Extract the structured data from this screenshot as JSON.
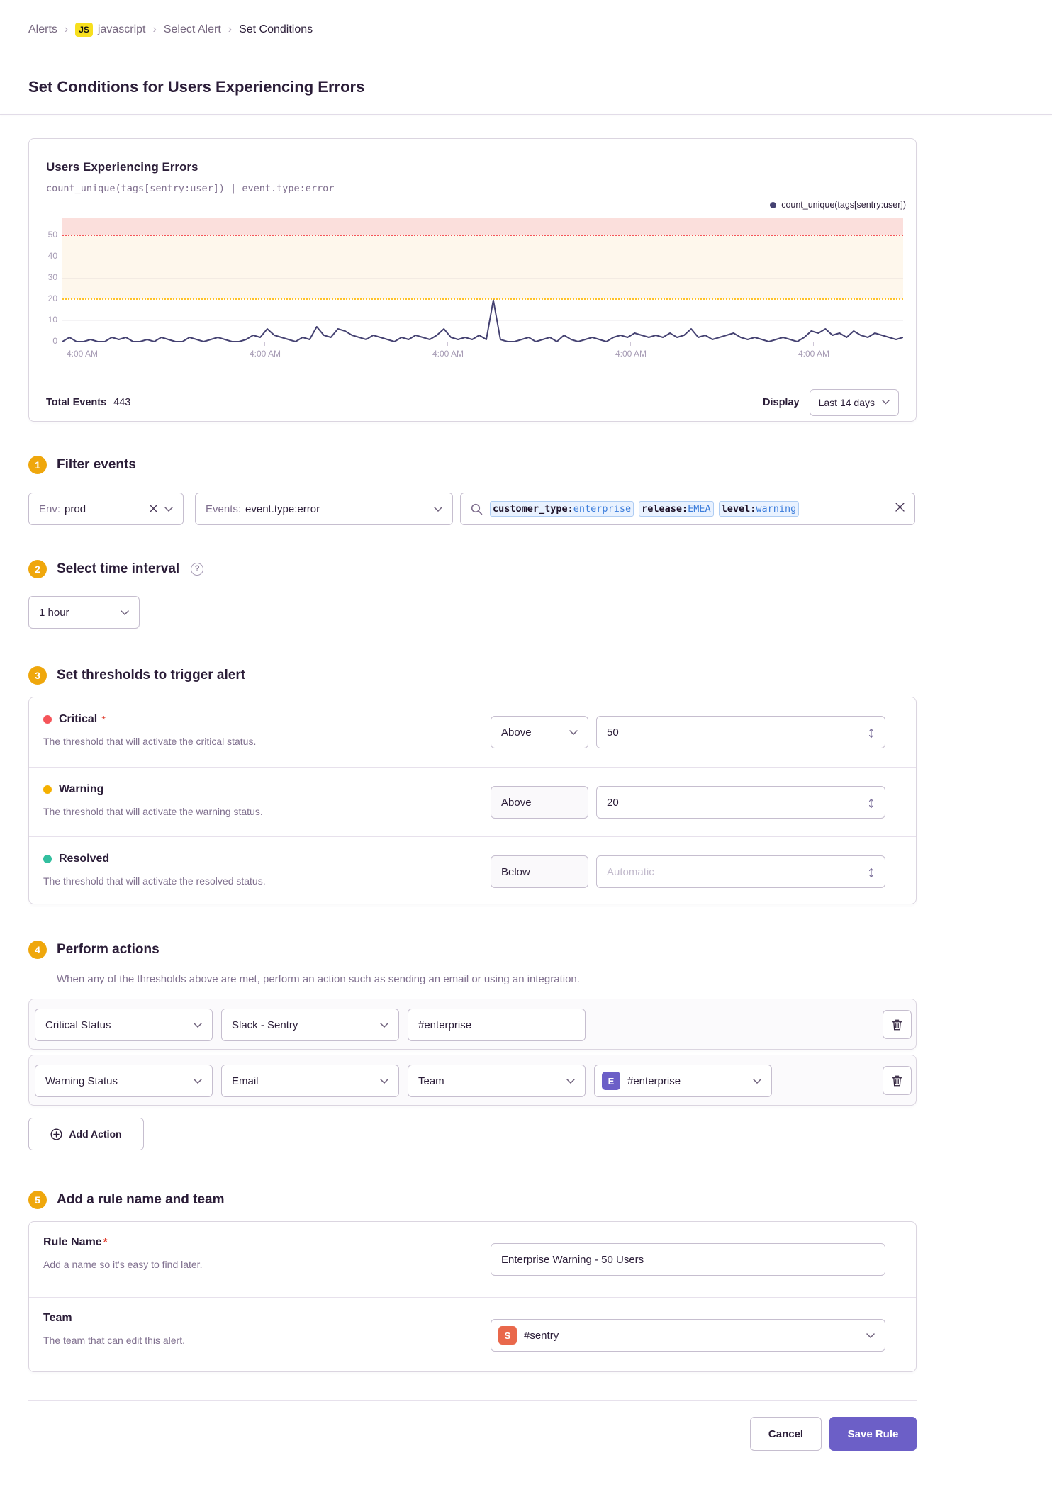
{
  "page": {
    "title": "Set Conditions for Users Experiencing Errors"
  },
  "breadcrumb": {
    "separator": "›",
    "project_badge": "JS",
    "items": [
      "Alerts",
      "javascript",
      "Select Alert",
      "Set Conditions"
    ]
  },
  "chart_panel": {
    "title": "Users Experiencing Errors",
    "query": "count_unique(tags[sentry:user]) | event.type:error",
    "legend": "count_unique(tags[sentry:user])",
    "total_events_label": "Total Events",
    "total_events_value": "443",
    "display_label": "Display",
    "range_value": "Last 14 days"
  },
  "chart_data": {
    "type": "line",
    "title": "Users Experiencing Errors",
    "series": [
      {
        "name": "count_unique(tags[sentry:user])",
        "values": [
          0,
          2,
          0,
          0,
          1,
          0,
          0,
          2,
          1,
          2,
          0,
          0,
          1,
          0,
          2,
          1,
          0,
          0,
          2,
          1,
          0,
          1,
          2,
          1,
          0,
          0,
          1,
          3,
          2,
          6,
          3,
          2,
          1,
          0,
          2,
          1,
          7,
          3,
          2,
          6,
          5,
          3,
          2,
          1,
          3,
          2,
          1,
          0,
          2,
          1,
          3,
          2,
          1,
          3,
          6,
          2,
          1,
          2,
          1,
          3,
          1,
          19.5,
          1,
          0,
          0,
          1,
          2,
          0,
          1,
          2,
          0,
          3,
          1,
          0,
          1,
          2,
          1,
          0,
          2,
          3,
          2,
          4,
          3,
          2,
          3,
          2,
          4,
          2,
          3,
          6,
          2,
          3,
          1,
          2,
          3,
          4,
          2,
          1,
          2,
          1,
          0,
          1,
          2,
          1,
          0,
          2,
          5,
          4,
          6,
          3,
          4,
          2,
          5,
          3,
          2,
          4,
          3,
          2,
          1,
          2
        ]
      }
    ],
    "ylim": [
      0,
      58.3
    ],
    "yticks": [
      0,
      10,
      20,
      30,
      40,
      50
    ],
    "xticks": [
      "4:00 AM",
      "4:00 AM",
      "4:00 AM",
      "4:00 AM",
      "4:00 AM"
    ],
    "thresholds": {
      "critical": 50,
      "warning": 20
    },
    "grid": true,
    "legend_position": "top-right",
    "colors": {
      "line": "#454272",
      "critical_line": "#F55459",
      "warning_line": "#FFC227",
      "critical_band": "#FBDFDC",
      "warning_band": "#FEF7EC"
    }
  },
  "steps": {
    "s1": {
      "num": "1",
      "heading": "Filter events"
    },
    "s2": {
      "num": "2",
      "heading": "Select time interval"
    },
    "s3": {
      "num": "3",
      "heading": "Set thresholds to trigger alert"
    },
    "s4": {
      "num": "4",
      "heading": "Perform actions",
      "description": "When any of the thresholds above are met, perform an action such as sending an email or using an integration."
    },
    "s5": {
      "num": "5",
      "heading": "Add a rule name and team"
    }
  },
  "filters": {
    "env": {
      "label": "Env:",
      "value": "prod"
    },
    "events": {
      "label": "Events:",
      "value": "event.type:error"
    },
    "search": {
      "tokens": [
        {
          "key": "customer_type:",
          "value": "enterprise"
        },
        {
          "key": "release:",
          "value": "EMEA"
        },
        {
          "key": "level:",
          "value": "warning"
        }
      ]
    }
  },
  "interval": {
    "value": "1 hour"
  },
  "thresholds": {
    "rows": [
      {
        "name": "Critical",
        "required": "*",
        "description": "The threshold that will activate the critical status.",
        "operator": "Above",
        "value": "50",
        "dot_color": "#F55459"
      },
      {
        "name": "Warning",
        "description": "The threshold that will activate the warning status.",
        "operator": "Above",
        "value": "20",
        "dot_color": "#F5B000"
      },
      {
        "name": "Resolved",
        "description": "The threshold that will activate the resolved status.",
        "operator": "Below",
        "placeholder": "Automatic",
        "dot_color": "#33BF9F"
      }
    ]
  },
  "actions": {
    "rows": [
      {
        "status": "Critical Status",
        "integration": "Slack - Sentry",
        "target": "#enterprise"
      },
      {
        "status": "Warning Status",
        "integration": "Email",
        "target_type": "Team",
        "team_badge": "E",
        "team_value": "#enterprise"
      }
    ],
    "add_label": "Add Action"
  },
  "rule": {
    "name": {
      "label": "Rule Name",
      "required": "*",
      "description": "Add a name so it's easy to find later.",
      "value": "Enterprise Warning - 50 Users"
    },
    "team": {
      "label": "Team",
      "description": "The team that can edit this alert.",
      "badge": "S",
      "badge_color": "#E9684B",
      "value": "#sentry"
    }
  },
  "footer": {
    "cancel": "Cancel",
    "save": "Save Rule"
  },
  "colors": {
    "accent": "#6C5FC7",
    "step_badge": "#EFA70C",
    "js_yellow": "#F7DF1E",
    "team_badge_purple": "#6C5FC7"
  }
}
